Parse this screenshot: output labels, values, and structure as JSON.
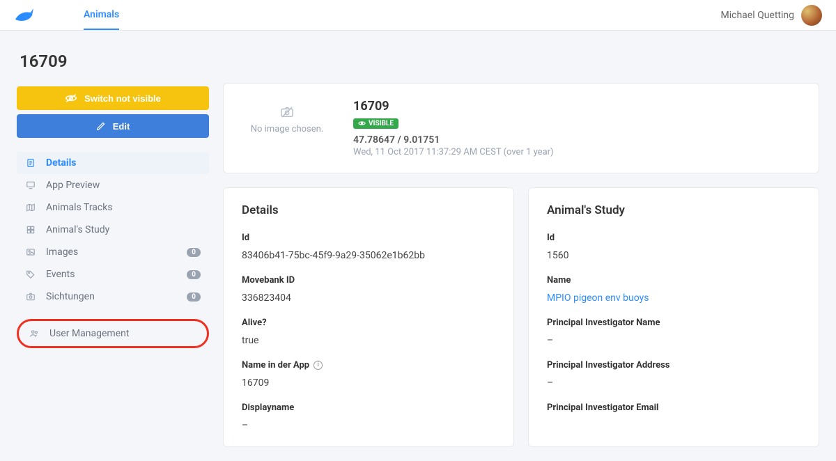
{
  "nav": {
    "link": "Animals"
  },
  "user": {
    "name": "Michael Quetting"
  },
  "page": {
    "title": "16709"
  },
  "actions": {
    "switch_not_visible": "Switch not visible",
    "edit": "Edit"
  },
  "sidebar": {
    "details": "Details",
    "app_preview": "App Preview",
    "animals_tracks": "Animals Tracks",
    "animals_study": "Animal's Study",
    "images": "Images",
    "images_count": "0",
    "events": "Events",
    "events_count": "0",
    "sichtungen": "Sichtungen",
    "sichtungen_count": "0",
    "user_management": "User Management"
  },
  "header_card": {
    "no_image": "No image chosen.",
    "title": "16709",
    "visibility": "VISIBLE",
    "coords": "47.78647 / 9.01751",
    "timestamp": "Wed, 11 Oct 2017 11:37:29 AM CEST (over 1 year)"
  },
  "details": {
    "title": "Details",
    "id_label": "Id",
    "id_value": "83406b41-75bc-45f9-9a29-35062e1b62bb",
    "movebank_label": "Movebank ID",
    "movebank_value": "336823404",
    "alive_label": "Alive?",
    "alive_value": "true",
    "name_app_label": "Name in der App",
    "name_app_value": "16709",
    "displayname_label": "Displayname",
    "displayname_value": "–"
  },
  "study": {
    "title": "Animal's Study",
    "id_label": "Id",
    "id_value": "1560",
    "name_label": "Name",
    "name_value": "MPIO pigeon env buoys",
    "pi_name_label": "Principal Investigator Name",
    "pi_name_value": "–",
    "pi_addr_label": "Principal Investigator Address",
    "pi_addr_value": "–",
    "pi_email_label": "Principal Investigator Email"
  }
}
